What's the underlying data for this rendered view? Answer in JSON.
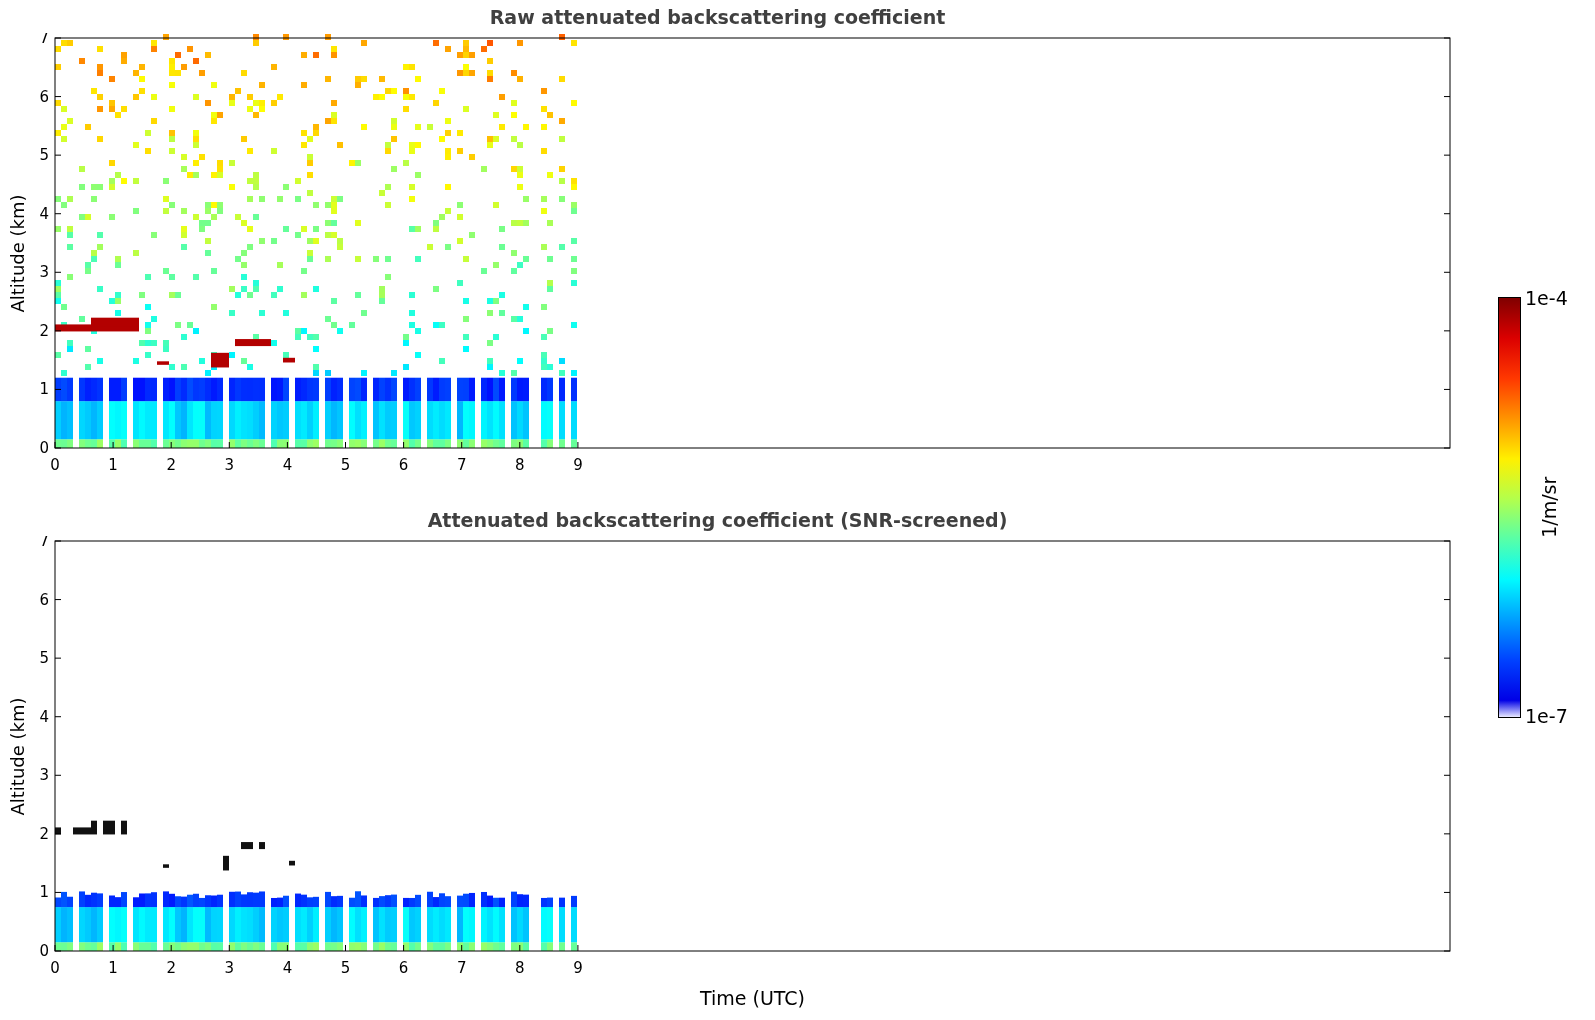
{
  "panels": [
    {
      "kind": "raw",
      "title": "Raw attenuated backscattering coefficient",
      "ylabel": "Altitude (km)",
      "yticks": [
        "7",
        "6",
        "5",
        "4",
        "3",
        "2",
        "1",
        "0"
      ],
      "xticks": [
        "0",
        "1",
        "2",
        "3",
        "4",
        "5",
        "6",
        "7",
        "8",
        "9"
      ]
    },
    {
      "kind": "screened",
      "title": "Attenuated backscattering coefficient (SNR-screened)",
      "ylabel": "Altitude (km)",
      "yticks": [
        "7",
        "6",
        "5",
        "4",
        "3",
        "2",
        "1",
        "0"
      ],
      "xticks": [
        "0",
        "1",
        "2",
        "3",
        "4",
        "5",
        "6",
        "7",
        "8",
        "9"
      ]
    }
  ],
  "xlabel": "Time (UTC)",
  "colorbar": {
    "max_label": "1e-4",
    "min_label": "1e-7",
    "unit": "1/m/sr"
  }
}
